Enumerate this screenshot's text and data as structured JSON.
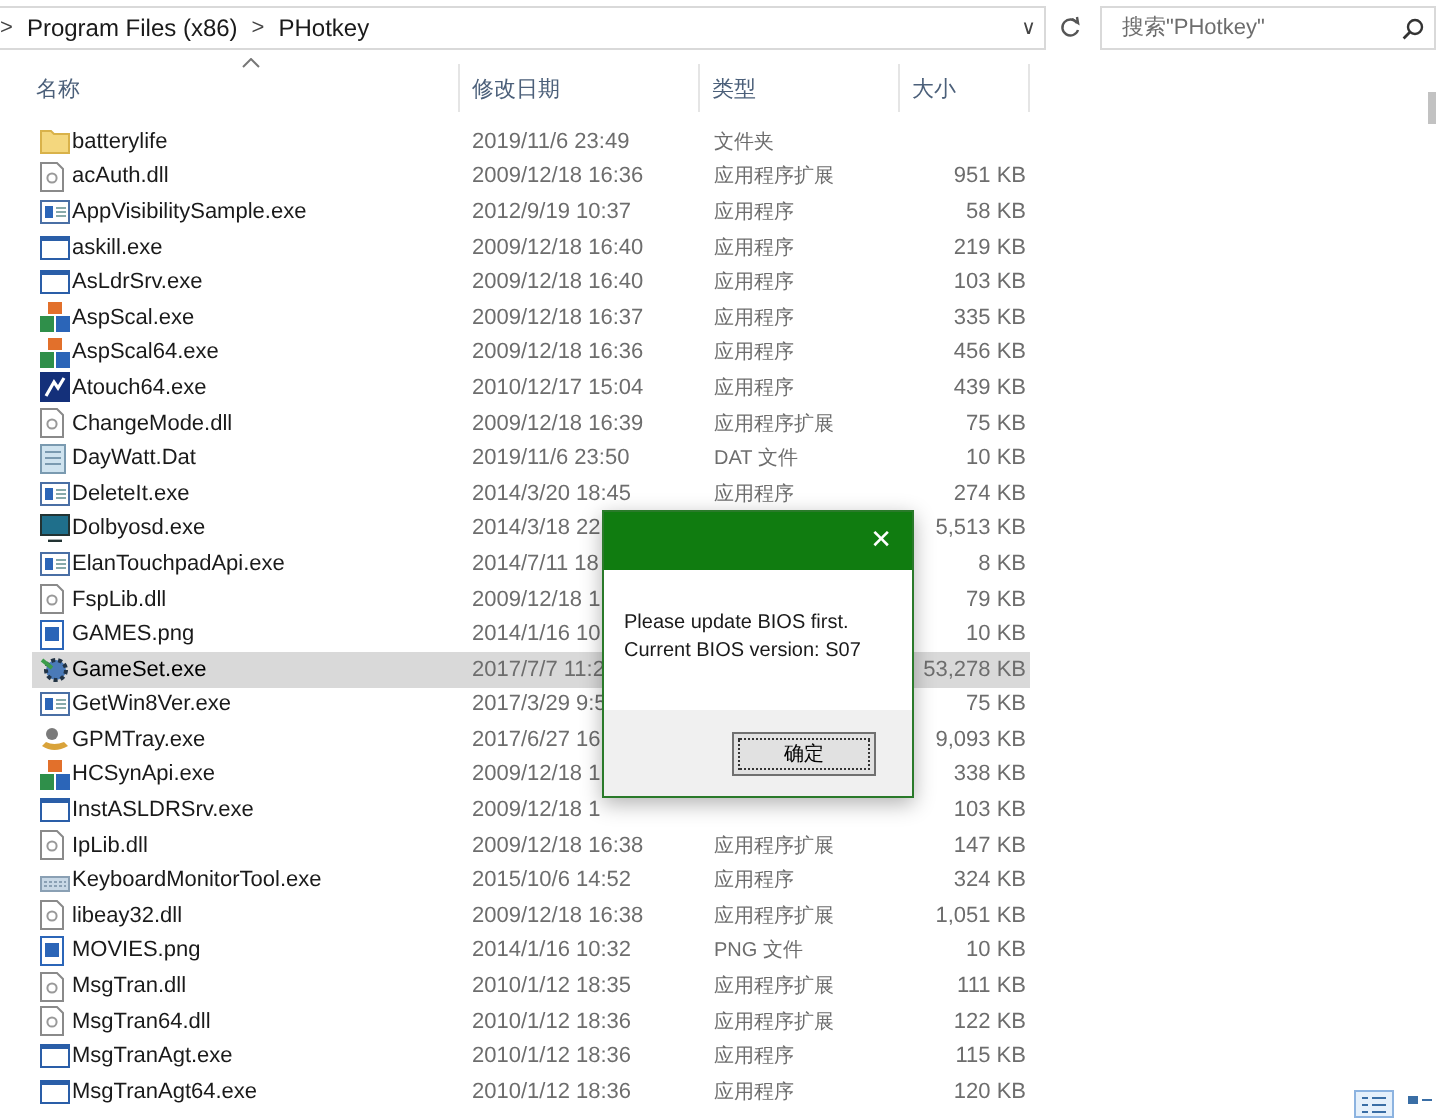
{
  "address_bar": {
    "separators": [
      ">",
      ">"
    ],
    "crumbs": [
      "Program Files (x86)",
      "PHotkey"
    ],
    "dropdown": "∨"
  },
  "search": {
    "placeholder": "搜索\"PHotkey\""
  },
  "columns": [
    {
      "label": "名称",
      "sorted": true
    },
    {
      "label": "修改日期",
      "sorted": false
    },
    {
      "label": "类型",
      "sorted": false
    },
    {
      "label": "大小",
      "sorted": false
    }
  ],
  "files": [
    {
      "kind": "folder",
      "name": "batterylife",
      "date": "2019/11/6 23:49",
      "type": "文件夹",
      "selected": false
    },
    {
      "kind": "dll",
      "name": "acAuth.dll",
      "date": "2009/12/18 16:36",
      "type": "应用程序扩展",
      "size": "951 KB",
      "selected": false
    },
    {
      "kind": "exe",
      "name": "AppVisibilitySample.exe",
      "date": "2012/9/19 10:37",
      "type": "应用程序",
      "size": "58 KB",
      "selected": false
    },
    {
      "kind": "window",
      "name": "askill.exe",
      "date": "2009/12/18 16:40",
      "type": "应用程序",
      "size": "219 KB",
      "selected": false
    },
    {
      "kind": "window",
      "name": "AsLdrSrv.exe",
      "date": "2009/12/18 16:40",
      "type": "应用程序",
      "size": "103 KB",
      "selected": false
    },
    {
      "kind": "blocks",
      "name": "AspScal.exe",
      "date": "2009/12/18 16:37",
      "type": "应用程序",
      "size": "335 KB",
      "selected": false
    },
    {
      "kind": "blocks",
      "name": "AspScal64.exe",
      "date": "2009/12/18 16:36",
      "type": "应用程序",
      "size": "456 KB",
      "selected": false
    },
    {
      "kind": "dark",
      "name": "Atouch64.exe",
      "date": "2010/12/17 15:04",
      "type": "应用程序",
      "size": "439 KB",
      "selected": false
    },
    {
      "kind": "dll",
      "name": "ChangeMode.dll",
      "date": "2009/12/18 16:39",
      "type": "应用程序扩展",
      "size": "75 KB",
      "selected": false
    },
    {
      "kind": "dat",
      "name": "DayWatt.Dat",
      "date": "2019/11/6 23:50",
      "type": "DAT 文件",
      "size": "10 KB",
      "selected": false
    },
    {
      "kind": "exe",
      "name": "DeleteIt.exe",
      "date": "2014/3/20 18:45",
      "type": "应用程序",
      "size": "274 KB",
      "selected": false
    },
    {
      "kind": "monitor",
      "name": "Dolbyosd.exe",
      "date": "2014/3/18 22",
      "size": "5,513 KB",
      "selected": false
    },
    {
      "kind": "exe",
      "name": "ElanTouchpadApi.exe",
      "date": "2014/7/11 18",
      "size": "8 KB",
      "selected": false
    },
    {
      "kind": "dll",
      "name": "FspLib.dll",
      "date": "2009/12/18 1",
      "size": "79 KB",
      "selected": false
    },
    {
      "kind": "image",
      "name": "GAMES.png",
      "date": "2014/1/16 10",
      "size": "10 KB",
      "selected": false
    },
    {
      "kind": "gear",
      "name": "GameSet.exe",
      "date": "2017/7/7 11:2",
      "size": "53,278 KB",
      "selected": true
    },
    {
      "kind": "exe",
      "name": "GetWin8Ver.exe",
      "date": "2017/3/29 9:5",
      "size": "75 KB",
      "selected": false
    },
    {
      "kind": "tray",
      "name": "GPMTray.exe",
      "date": "2017/6/27 16",
      "size": "9,093 KB",
      "selected": false
    },
    {
      "kind": "blocks",
      "name": "HCSynApi.exe",
      "date": "2009/12/18 1",
      "size": "338 KB",
      "selected": false
    },
    {
      "kind": "window",
      "name": "InstASLDRSrv.exe",
      "date": "2009/12/18 1",
      "size": "103 KB",
      "selected": false
    },
    {
      "kind": "dll",
      "name": "IpLib.dll",
      "date": "2009/12/18 16:38",
      "type": "应用程序扩展",
      "size": "147 KB",
      "selected": false
    },
    {
      "kind": "keyboard",
      "name": "KeyboardMonitorTool.exe",
      "date": "2015/10/6 14:52",
      "type": "应用程序",
      "size": "324 KB",
      "selected": false
    },
    {
      "kind": "dll",
      "name": "libeay32.dll",
      "date": "2009/12/18 16:38",
      "type": "应用程序扩展",
      "size": "1,051 KB",
      "selected": false
    },
    {
      "kind": "image",
      "name": "MOVIES.png",
      "date": "2014/1/16 10:32",
      "type": "PNG 文件",
      "size": "10 KB",
      "selected": false
    },
    {
      "kind": "dll",
      "name": "MsgTran.dll",
      "date": "2010/1/12 18:35",
      "type": "应用程序扩展",
      "size": "111 KB",
      "selected": false
    },
    {
      "kind": "dll",
      "name": "MsgTran64.dll",
      "date": "2010/1/12 18:36",
      "type": "应用程序扩展",
      "size": "122 KB",
      "selected": false
    },
    {
      "kind": "window",
      "name": "MsgTranAgt.exe",
      "date": "2010/1/12 18:36",
      "type": "应用程序",
      "size": "115 KB",
      "selected": false
    },
    {
      "kind": "window",
      "name": "MsgTranAgt64.exe",
      "date": "2010/1/12 18:36",
      "type": "应用程序",
      "size": "120 KB",
      "selected": false
    }
  ],
  "dialog": {
    "close": "✕",
    "lines": [
      "Please update BIOS first.",
      "Current BIOS version: S07"
    ],
    "button": "确定"
  },
  "view_buttons": [
    {
      "kind": "details",
      "selected": true
    },
    {
      "kind": "tiles",
      "selected": false
    }
  ]
}
